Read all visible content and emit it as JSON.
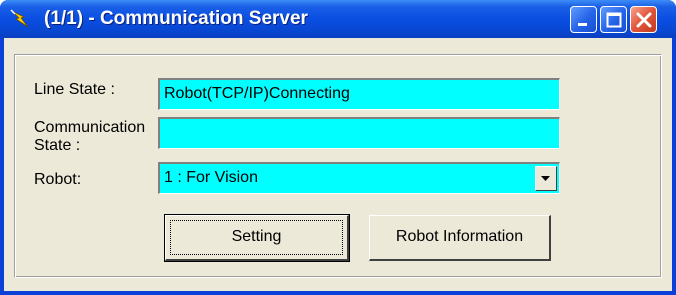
{
  "window": {
    "title": "(1/1) - Communication Server",
    "icon": "lightning-app-icon"
  },
  "titlebar_buttons": {
    "minimize": "minimize-icon",
    "maximize": "maximize-icon",
    "close": "close-icon"
  },
  "form": {
    "line_state_label": "Line State :",
    "line_state_value": "Robot(TCP/IP)Connecting",
    "comm_state_label_line1": "Communication",
    "comm_state_label_line2": "State :",
    "comm_state_value": "",
    "robot_label": "Robot:",
    "robot_selected": "1 : For Vision"
  },
  "buttons": {
    "setting": "Setting",
    "robot_information": "Robot Information"
  },
  "colors": {
    "field_background": "#00ffff",
    "client_background": "#ece9d8",
    "titlebar": "#0a4ee2"
  }
}
